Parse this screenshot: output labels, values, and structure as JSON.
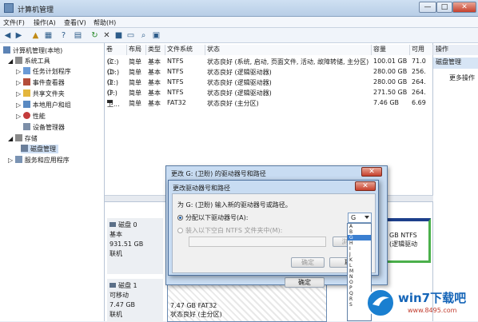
{
  "window": {
    "title": "计算机管理",
    "min": "—",
    "max": "□",
    "close": "✕"
  },
  "menu": [
    "文件(F)",
    "操作(A)",
    "查看(V)",
    "帮助(H)"
  ],
  "tree": {
    "root": "计算机管理(本地)",
    "items": [
      "系统工具",
      "任务计划程序",
      "事件查看器",
      "共享文件夹",
      "本地用户和组",
      "性能",
      "设备管理器",
      "存储",
      "磁盘管理",
      "服务和应用程序"
    ]
  },
  "columns": [
    "卷",
    "布局",
    "类型",
    "文件系统",
    "状态",
    "容量",
    "可用"
  ],
  "volumes": [
    {
      "vol": "(C:)",
      "layout": "简单",
      "type": "基本",
      "fs": "NTFS",
      "status": "状态良好 (系统, 启动, 页面文件, 活动, 故障转储, 主分区)",
      "cap": "100.01 GB",
      "free": "71.0"
    },
    {
      "vol": "(D:)",
      "layout": "简单",
      "type": "基本",
      "fs": "NTFS",
      "status": "状态良好 (逻辑驱动器)",
      "cap": "280.00 GB",
      "free": "256."
    },
    {
      "vol": "(E:)",
      "layout": "简单",
      "type": "基本",
      "fs": "NTFS",
      "status": "状态良好 (逻辑驱动器)",
      "cap": "280.00 GB",
      "free": "264."
    },
    {
      "vol": "(F:)",
      "layout": "简单",
      "type": "基本",
      "fs": "NTFS",
      "status": "状态良好 (逻辑驱动器)",
      "cap": "271.50 GB",
      "free": "264."
    },
    {
      "vol": "卫...",
      "layout": "简单",
      "type": "基本",
      "fs": "FAT32",
      "status": "状态良好 (主分区)",
      "cap": "7.46 GB",
      "free": "6.69"
    }
  ],
  "actions": {
    "header": "操作",
    "selected": "磁盘管理",
    "more": "更多操作"
  },
  "disks": [
    {
      "name": "磁盘 0",
      "type": "基本",
      "size": "931.51 GB",
      "status": "联机"
    },
    {
      "name": "磁盘 1",
      "type": "可移动",
      "size": "7.47 GB",
      "status": "联机"
    }
  ],
  "disk0_vol": {
    "line1": "GB NTFS",
    "line2": "(逻辑驱动"
  },
  "disk1_vol": {
    "line1": "7.47 GB FAT32",
    "line2": "状态良好 (主分区)"
  },
  "outer_dialog": {
    "title": "更改 G: (卫盼) 的驱动器号和路径",
    "ok": "确定"
  },
  "inner_dialog": {
    "title": "更改驱动器号和路径",
    "prompt": "为 G: (卫盼) 输入新的驱动器号或路径。",
    "option1": "分配以下驱动器号(A):",
    "option2": "装入以下空白 NTFS 文件夹中(M):",
    "browse": "浏览(",
    "ok": "确定",
    "cancel": "取"
  },
  "combo_value": "G",
  "letters": [
    "A",
    "B",
    "G",
    "H",
    "I",
    "J",
    "K",
    "L",
    "M",
    "N",
    "O",
    "P",
    "Q",
    "R",
    "S"
  ],
  "watermark": {
    "brand": "win7下载吧",
    "url": "www.8495.com"
  }
}
